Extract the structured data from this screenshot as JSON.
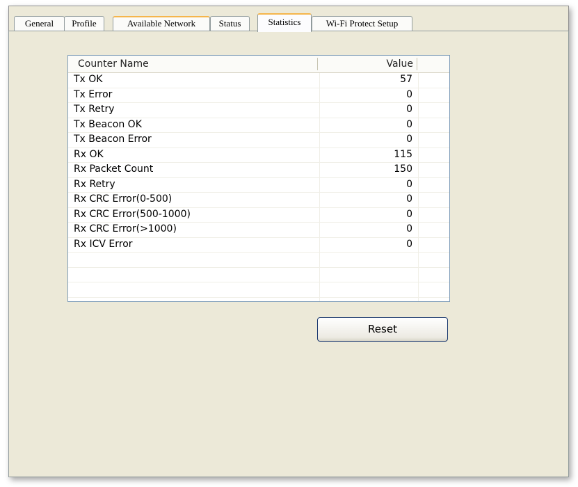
{
  "tabs": [
    {
      "label": "General"
    },
    {
      "label": "Profile"
    },
    {
      "label": "Available Network"
    },
    {
      "label": "Status"
    },
    {
      "label": "Statistics"
    },
    {
      "label": "Wi-Fi Protect Setup"
    }
  ],
  "active_tab": "Statistics",
  "table": {
    "columns": [
      "Counter Name",
      "Value"
    ],
    "rows": [
      {
        "name": "Tx OK",
        "value": "57"
      },
      {
        "name": "Tx Error",
        "value": "0"
      },
      {
        "name": "Tx Retry",
        "value": "0"
      },
      {
        "name": "Tx Beacon OK",
        "value": "0"
      },
      {
        "name": "Tx Beacon Error",
        "value": "0"
      },
      {
        "name": "Rx OK",
        "value": "115"
      },
      {
        "name": "Rx Packet Count",
        "value": "150"
      },
      {
        "name": "Rx Retry",
        "value": "0"
      },
      {
        "name": "Rx CRC Error(0-500)",
        "value": "0"
      },
      {
        "name": "Rx CRC Error(500-1000)",
        "value": "0"
      },
      {
        "name": "Rx CRC Error(>1000)",
        "value": "0"
      },
      {
        "name": "Rx ICV Error",
        "value": "0"
      }
    ]
  },
  "buttons": {
    "reset_label": "Reset"
  },
  "colors": {
    "window_bg": "#ece9d8",
    "tab_highlight": "#f5b54b",
    "list_border": "#7f9db9"
  }
}
